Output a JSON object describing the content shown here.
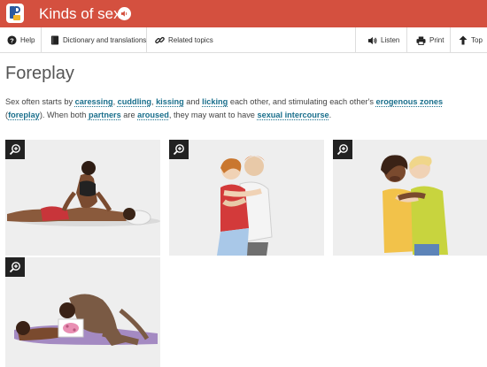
{
  "header": {
    "title": "Kinds of sex",
    "brand_color": "#d4503f"
  },
  "toolbar": {
    "help": "Help",
    "dictionary": "Dictionary and translations",
    "related": "Related topics",
    "listen": "Listen",
    "print": "Print",
    "top": "Top"
  },
  "main": {
    "heading": "Foreplay",
    "paragraph": {
      "t1": "Sex often starts by ",
      "caressing": "caressing",
      "t2": ", ",
      "cuddling": "cuddling",
      "t3": ", ",
      "kissing": "kissing",
      "t4": " and ",
      "licking": "licking",
      "t5": " each other, and stimulating each other's ",
      "erogenous_zones": "erogenous zones",
      "t6": " (",
      "foreplay": "foreplay",
      "t7": "). When both ",
      "partners": "partners",
      "t8": " are ",
      "aroused": "aroused",
      "t9": ", they may want to have ",
      "sexual_intercourse": "sexual intercourse",
      "t10": "."
    },
    "link_color": "#1a6f8c"
  },
  "images": [
    {
      "icon": "zoom-icon"
    },
    {
      "icon": "zoom-icon"
    },
    {
      "icon": "zoom-icon"
    },
    {
      "icon": "zoom-icon"
    }
  ]
}
